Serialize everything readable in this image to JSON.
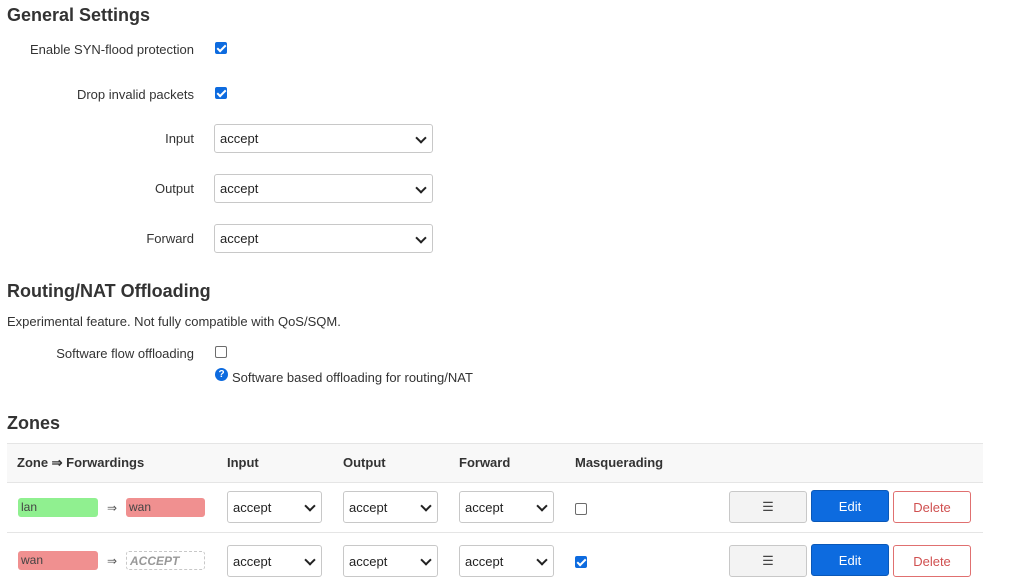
{
  "general": {
    "title": "General Settings",
    "syn_flood_label": "Enable SYN-flood protection",
    "syn_flood_checked": true,
    "drop_invalid_label": "Drop invalid packets",
    "drop_invalid_checked": true,
    "input_label": "Input",
    "input_value": "accept",
    "output_label": "Output",
    "output_value": "accept",
    "forward_label": "Forward",
    "forward_value": "accept"
  },
  "offloading": {
    "title": "Routing/NAT Offloading",
    "description": "Experimental feature. Not fully compatible with QoS/SQM.",
    "sw_flow_label": "Software flow offloading",
    "sw_flow_checked": false,
    "sw_flow_help": "Software based offloading for routing/NAT"
  },
  "zones": {
    "title": "Zones",
    "headers": [
      "Zone ⇒ Forwardings",
      "Input",
      "Output",
      "Forward",
      "Masquerading"
    ],
    "arrow": "⇒",
    "rows": [
      {
        "zone": "lan",
        "zone_color": "#90f090",
        "dest": "wan",
        "dest_color": "#f09090",
        "input": "accept",
        "output": "accept",
        "forward": "accept",
        "masq": false
      },
      {
        "zone": "wan",
        "zone_color": "#f09090",
        "dest": "ACCEPT",
        "input": "accept",
        "output": "accept",
        "forward": "accept",
        "masq": true
      }
    ],
    "menu_icon": "☰",
    "edit_label": "Edit",
    "delete_label": "Delete"
  },
  "colors": {
    "accent": "#0d6bdf",
    "lan": "#90f090",
    "wan": "#f09090",
    "delete": "#d05050"
  }
}
